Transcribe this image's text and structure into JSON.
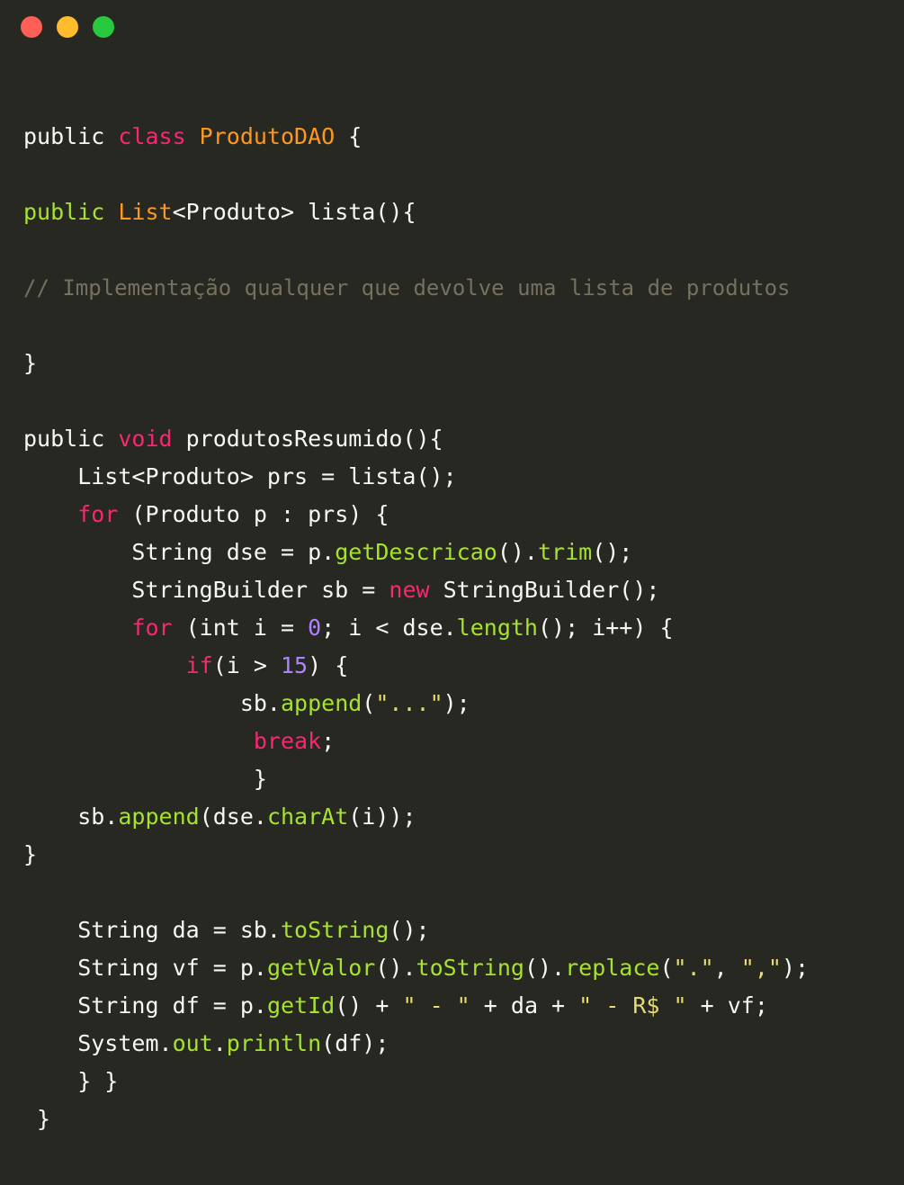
{
  "window": {
    "controls": [
      {
        "name": "close-button",
        "color": "#ff5f56"
      },
      {
        "name": "minimize-button",
        "color": "#ffbd2e"
      },
      {
        "name": "maximize-button",
        "color": "#27c93f"
      }
    ]
  },
  "theme": {
    "background": "#272822",
    "plain": "#f8f8f2",
    "keyword": "#f92672",
    "keyword_green": "#a6e22e",
    "class_name": "#fd971f",
    "function": "#a6e22e",
    "number": "#ae81ff",
    "string": "#e6db74",
    "comment": "#75715e"
  },
  "code": {
    "lines": [
      [
        {
          "t": "plain",
          "v": "public "
        },
        {
          "t": "kw",
          "v": "class "
        },
        {
          "t": "cls",
          "v": "ProdutoDAO"
        },
        {
          "t": "plain",
          "v": " {"
        }
      ],
      [],
      [
        {
          "t": "kwg",
          "v": "public "
        },
        {
          "t": "cls",
          "v": "List"
        },
        {
          "t": "plain",
          "v": "<Produto> lista(){"
        }
      ],
      [],
      [
        {
          "t": "com",
          "v": "// Implementação qualquer que devolve uma lista de produtos"
        }
      ],
      [],
      [
        {
          "t": "plain",
          "v": "}"
        }
      ],
      [],
      [
        {
          "t": "plain",
          "v": "public "
        },
        {
          "t": "kw",
          "v": "void"
        },
        {
          "t": "plain",
          "v": " produtosResumido(){"
        }
      ],
      [
        {
          "t": "plain",
          "v": "    List<Produto> prs = lista();"
        }
      ],
      [
        {
          "t": "plain",
          "v": "    "
        },
        {
          "t": "kw",
          "v": "for"
        },
        {
          "t": "plain",
          "v": " (Produto p : prs) {"
        }
      ],
      [
        {
          "t": "plain",
          "v": "        String dse = p."
        },
        {
          "t": "fn",
          "v": "getDescricao"
        },
        {
          "t": "plain",
          "v": "()."
        },
        {
          "t": "fn",
          "v": "trim"
        },
        {
          "t": "plain",
          "v": "();"
        }
      ],
      [
        {
          "t": "plain",
          "v": "        StringBuilder sb = "
        },
        {
          "t": "kw",
          "v": "new"
        },
        {
          "t": "plain",
          "v": " StringBuilder();"
        }
      ],
      [
        {
          "t": "plain",
          "v": "        "
        },
        {
          "t": "kw",
          "v": "for"
        },
        {
          "t": "plain",
          "v": " (int i = "
        },
        {
          "t": "num",
          "v": "0"
        },
        {
          "t": "plain",
          "v": "; i < dse."
        },
        {
          "t": "fn",
          "v": "length"
        },
        {
          "t": "plain",
          "v": "(); i++) {"
        }
      ],
      [
        {
          "t": "plain",
          "v": "            "
        },
        {
          "t": "kw",
          "v": "if"
        },
        {
          "t": "plain",
          "v": "(i > "
        },
        {
          "t": "num",
          "v": "15"
        },
        {
          "t": "plain",
          "v": ") {"
        }
      ],
      [
        {
          "t": "plain",
          "v": "                sb."
        },
        {
          "t": "fn",
          "v": "append"
        },
        {
          "t": "plain",
          "v": "("
        },
        {
          "t": "str",
          "v": "\"...\""
        },
        {
          "t": "plain",
          "v": ");"
        }
      ],
      [
        {
          "t": "plain",
          "v": "                 "
        },
        {
          "t": "kw",
          "v": "break"
        },
        {
          "t": "plain",
          "v": ";"
        }
      ],
      [
        {
          "t": "plain",
          "v": "                 }"
        }
      ],
      [
        {
          "t": "plain",
          "v": "    sb."
        },
        {
          "t": "fn",
          "v": "append"
        },
        {
          "t": "plain",
          "v": "(dse."
        },
        {
          "t": "fn",
          "v": "charAt"
        },
        {
          "t": "plain",
          "v": "(i));"
        }
      ],
      [
        {
          "t": "plain",
          "v": "}"
        }
      ],
      [],
      [
        {
          "t": "plain",
          "v": "    String da = sb."
        },
        {
          "t": "fn",
          "v": "toString"
        },
        {
          "t": "plain",
          "v": "();"
        }
      ],
      [
        {
          "t": "plain",
          "v": "    String vf = p."
        },
        {
          "t": "fn",
          "v": "getValor"
        },
        {
          "t": "plain",
          "v": "()."
        },
        {
          "t": "fn",
          "v": "toString"
        },
        {
          "t": "plain",
          "v": "()."
        },
        {
          "t": "fn",
          "v": "replace"
        },
        {
          "t": "plain",
          "v": "("
        },
        {
          "t": "str",
          "v": "\".\""
        },
        {
          "t": "plain",
          "v": ", "
        },
        {
          "t": "str",
          "v": "\",\""
        },
        {
          "t": "plain",
          "v": ");"
        }
      ],
      [
        {
          "t": "plain",
          "v": "    String df = p."
        },
        {
          "t": "fn",
          "v": "getId"
        },
        {
          "t": "plain",
          "v": "() + "
        },
        {
          "t": "str",
          "v": "\" - \""
        },
        {
          "t": "plain",
          "v": " + da + "
        },
        {
          "t": "str",
          "v": "\" - R$ \""
        },
        {
          "t": "plain",
          "v": " + vf;"
        }
      ],
      [
        {
          "t": "plain",
          "v": "    System."
        },
        {
          "t": "fn",
          "v": "out"
        },
        {
          "t": "plain",
          "v": "."
        },
        {
          "t": "fn",
          "v": "println"
        },
        {
          "t": "plain",
          "v": "(df);"
        }
      ],
      [
        {
          "t": "plain",
          "v": "    } }"
        }
      ],
      [
        {
          "t": "plain",
          "v": " }"
        }
      ]
    ]
  }
}
